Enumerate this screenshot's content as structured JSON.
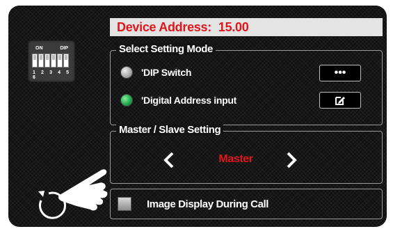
{
  "device_address": {
    "label": "Device Address:",
    "value": "15.00"
  },
  "dip_switch": {
    "on_label": "ON",
    "dip_label": "DIP",
    "numbers": "1 2 3 4 5 6"
  },
  "setting_mode": {
    "title": "Select Setting Mode",
    "options": [
      {
        "label": "'DIP Switch",
        "selected": false,
        "button_icon": "more-dots-icon",
        "button_text": "•••"
      },
      {
        "label": "'Digital Address input",
        "selected": true,
        "button_icon": "edit-icon"
      }
    ]
  },
  "master_slave": {
    "title": "Master / Slave Setting",
    "value": "Master"
  },
  "image_display": {
    "label": "Image Display During Call",
    "checked": false
  },
  "gesture": {
    "icon": "hand-swipe-back-icon"
  },
  "colors": {
    "accent_red": "#e0161b",
    "selected_green": "#1fa34a"
  }
}
